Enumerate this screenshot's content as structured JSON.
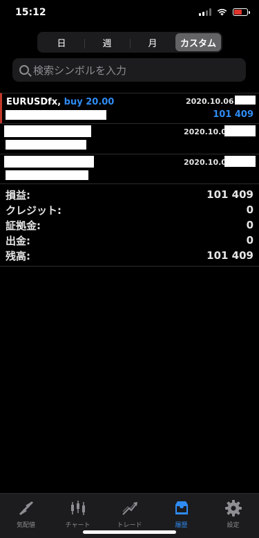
{
  "status": {
    "time": "15:12"
  },
  "segments": [
    "日",
    "週",
    "月",
    "カスタム"
  ],
  "search": {
    "placeholder": "検索シンボルを入力"
  },
  "deals": [
    {
      "symbol": "EURUSDfx,",
      "side": "buy 20.00",
      "date": "2020.10.06",
      "profit": "101 409"
    },
    {
      "date": "2020.10.06"
    },
    {
      "date": "2020.10.06"
    }
  ],
  "summary": [
    {
      "label": "損益:",
      "value": "101 409"
    },
    {
      "label": "クレジット:",
      "value": "0"
    },
    {
      "label": "証拠金:",
      "value": "0"
    },
    {
      "label": "出金:",
      "value": "0"
    },
    {
      "label": "残高:",
      "value": "101 409"
    }
  ],
  "tabs": [
    {
      "label": "気配値",
      "icon": "quotes-icon"
    },
    {
      "label": "チャート",
      "icon": "chart-icon"
    },
    {
      "label": "トレード",
      "icon": "trade-icon"
    },
    {
      "label": "履歴",
      "icon": "history-icon"
    },
    {
      "label": "設定",
      "icon": "settings-icon"
    }
  ],
  "colors": {
    "accent": "#2f8cf5",
    "selected_marker": "#c0392b",
    "battery": "#e0342c"
  }
}
